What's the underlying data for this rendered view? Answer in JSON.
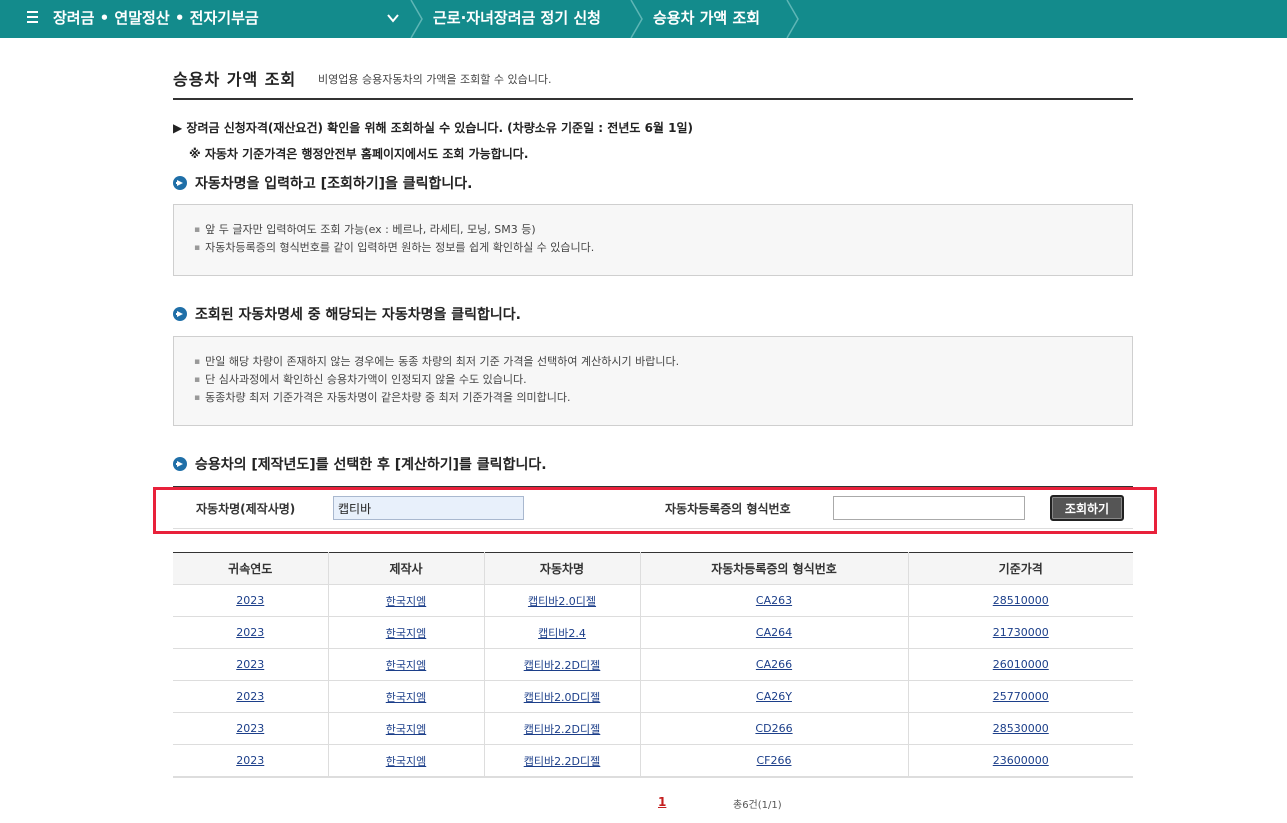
{
  "nav": {
    "menu": "장려금 • 연말정산 • 전자기부금",
    "crumb1": "근로·자녀장려금 정기 신청",
    "crumb2": "승용차 가액 조회"
  },
  "page": {
    "title": "승용차 가액 조회",
    "desc": "비영업용 승용자동차의 가액을 조회할 수 있습니다."
  },
  "notices": {
    "line1": "▶ 장려금 신청자격(재산요건) 확인을 위해 조회하실 수 있습니다. (차량소유 기준일 : 전년도 6월 1일)",
    "line2": "※ 자동차 기준가격은 행정안전부 홈페이지에서도 조회 가능합니다."
  },
  "steps": {
    "s1": {
      "title": "자동차명을 입력하고 [조회하기]을 클릭합니다.",
      "items": [
        "앞 두 글자만 입력하여도 조회 가능(ex : 베르나, 라세티, 모닝, SM3 등)",
        "자동차등록증의 형식번호를 같이 입력하면 원하는 정보를 쉽게 확인하실 수 있습니다."
      ]
    },
    "s2": {
      "title": "조회된 자동차명세 중 해당되는 자동차명을 클릭합니다.",
      "items": [
        "만일 해당 차량이 존재하지 않는 경우에는 동종 차량의 최저 기준 가격을 선택하여 계산하시기 바랍니다.",
        "단 심사과정에서 확인하신 승용차가액이 인정되지 않을 수도 있습니다.",
        "동종차량 최저 기준가격은 자동차명이 같은차량 중  최저 기준가격을 의미합니다."
      ]
    },
    "s3": {
      "title": "승용차의 [제작년도]를 선택한 후 [계산하기]를 클릭합니다."
    }
  },
  "search": {
    "name_label": "자동차명(제작사명)",
    "name_value": "캡티바",
    "type_label": "자동차등록증의 형식번호",
    "type_value": "",
    "button": "조회하기"
  },
  "table": {
    "headers": [
      "귀속연도",
      "제작사",
      "자동차명",
      "자동차등록증의 형식번호",
      "기준가격"
    ],
    "rows": [
      [
        "2023",
        "한국지엠",
        "캡티바2.0디젤",
        "CA263",
        "28510000"
      ],
      [
        "2023",
        "한국지엠",
        "캡티바2.4",
        "CA264",
        "21730000"
      ],
      [
        "2023",
        "한국지엠",
        "캡티바2.2D디젤",
        "CA266",
        "26010000"
      ],
      [
        "2023",
        "한국지엠",
        "캡티바2.0D디젤",
        "CA26Y",
        "25770000"
      ],
      [
        "2023",
        "한국지엠",
        "캡티바2.2D디젤",
        "CD266",
        "28530000"
      ],
      [
        "2023",
        "한국지엠",
        "캡티바2.2D디젤",
        "CF266",
        "23600000"
      ]
    ]
  },
  "pagination": {
    "current": "1",
    "total": "총6건(1/1)"
  },
  "colors": {
    "nav": "#138b8c",
    "highlight": "#e8213b",
    "link": "#1c3f8a"
  }
}
